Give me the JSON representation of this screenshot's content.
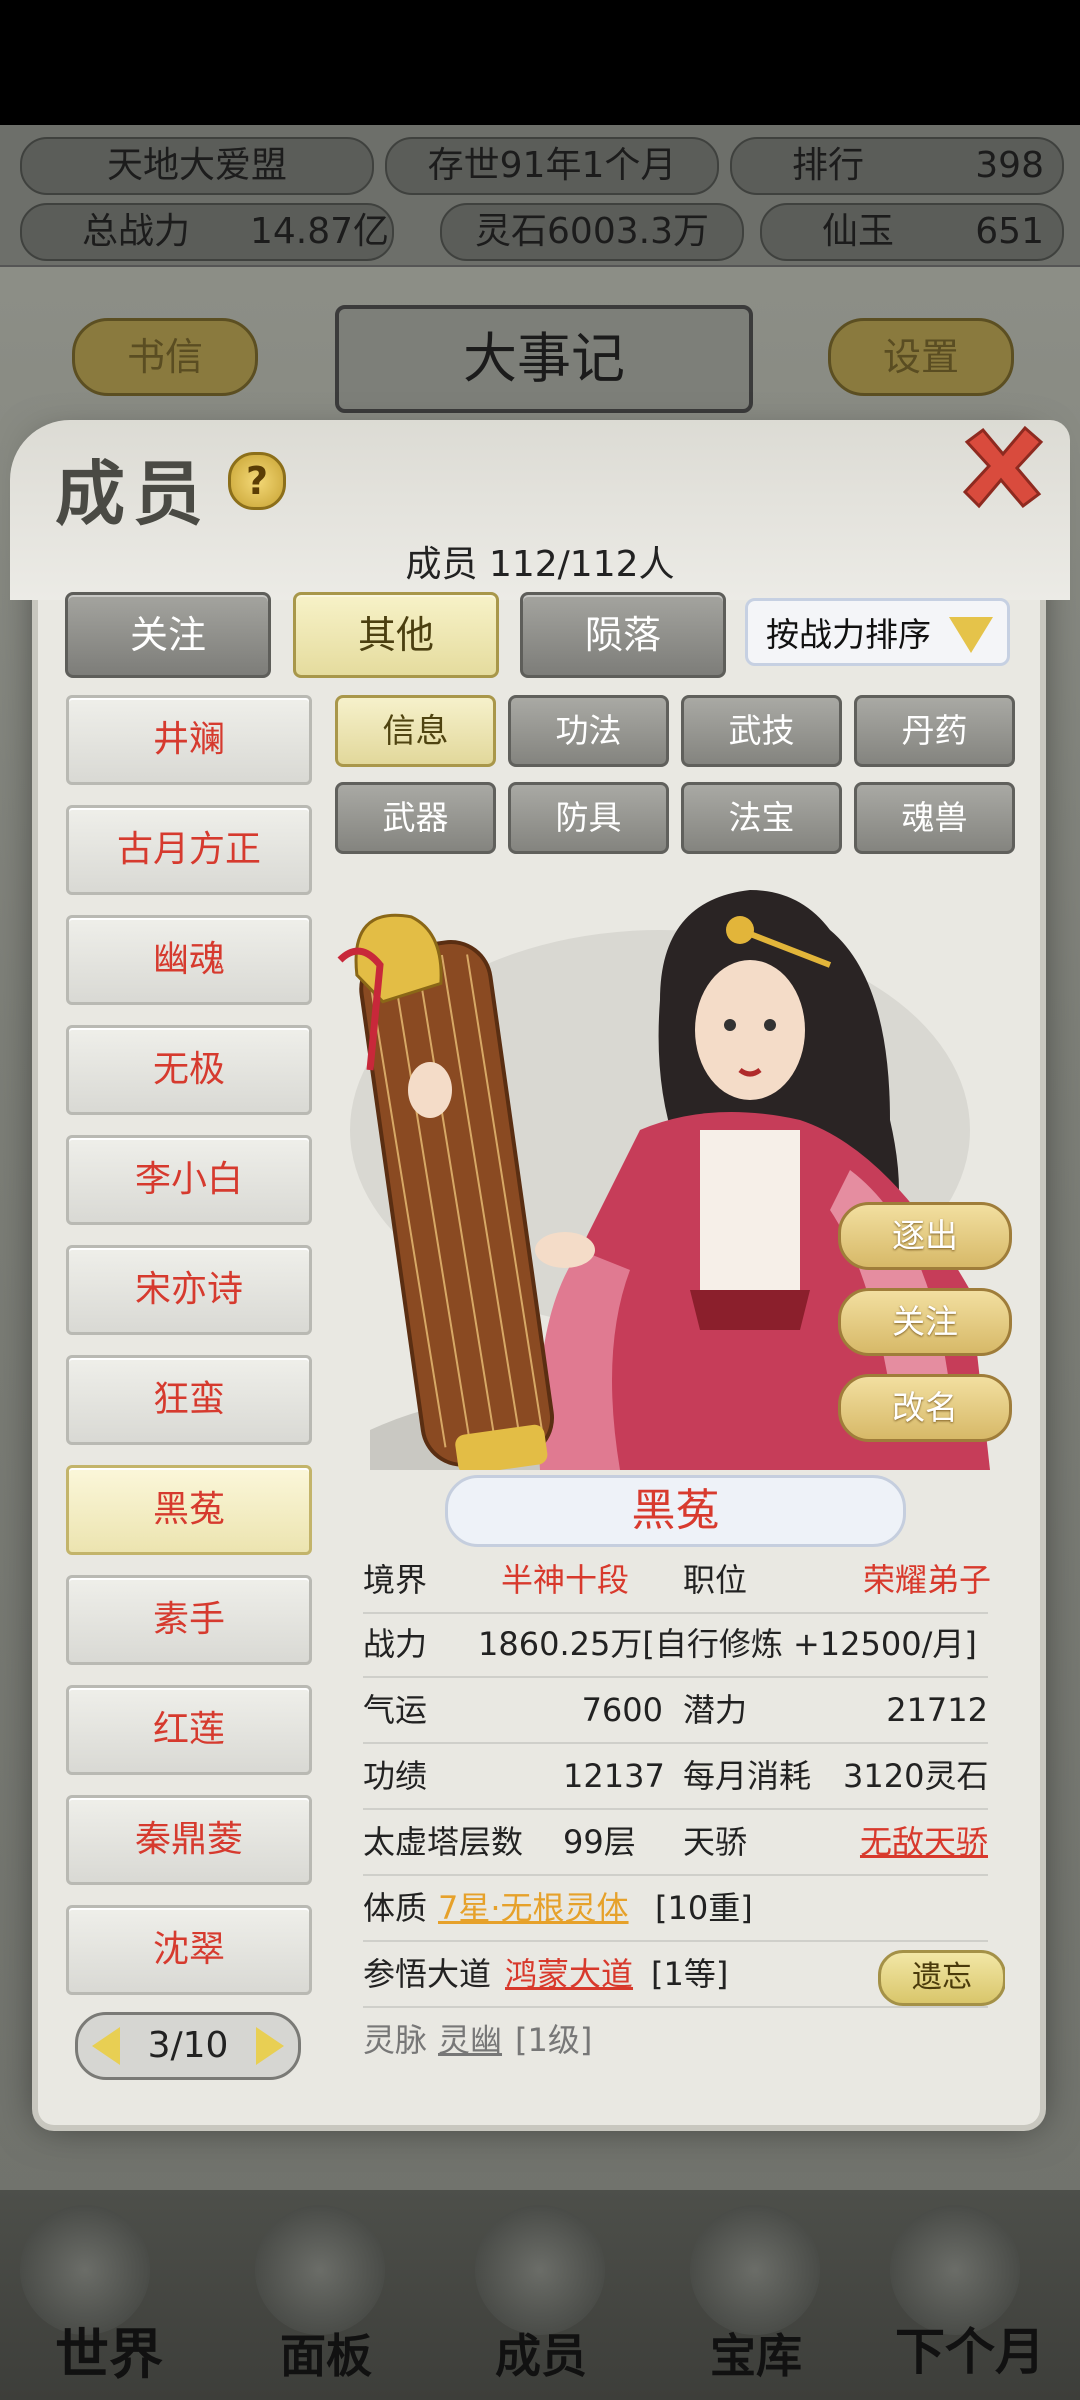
{
  "top": {
    "alliance": "天地大爱盟",
    "era": "存世91年1个月",
    "rank_label": "排行",
    "rank_value": "398",
    "power_label": "总战力",
    "power_value": "14.87亿",
    "spirit_stone": "灵石6003.3万",
    "jade_label": "仙玉",
    "jade_value": "651"
  },
  "header": {
    "mail_label": "书信",
    "title": "大事记",
    "settings_label": "设置"
  },
  "modal": {
    "title": "成员",
    "help": "?",
    "member_count": "成员  112/112人",
    "tabs": [
      "关注",
      "其他",
      "陨落"
    ],
    "active_tab": "其他",
    "sort": "按战力排序",
    "categories": [
      "信息",
      "功法",
      "武技",
      "丹药",
      "武器",
      "防具",
      "法宝",
      "魂兽"
    ],
    "active_category": "信息",
    "members": [
      "井斓",
      "古月方正",
      "幽魂",
      "无极",
      "李小白",
      "宋亦诗",
      "狂蛮",
      "黑菟",
      "素手",
      "红莲",
      "秦鼎菱",
      "沈翠"
    ],
    "selected_member": "黑菟",
    "pager": "3/10",
    "actions": [
      "逐出",
      "关注",
      "改名"
    ],
    "name": "黑菟",
    "stats": {
      "realm_label": "境界",
      "realm_value": "半神十段",
      "position_label": "职位",
      "position_value": "荣耀弟子",
      "power_label": "战力",
      "power_value": "1860.25万[自行修炼 +12500/月]",
      "luck_label": "气运",
      "luck_value": "7600",
      "potential_label": "潜力",
      "potential_value": "21712",
      "merit_label": "功绩",
      "merit_value": "12137",
      "cost_label": "每月消耗",
      "cost_value": "3120灵石",
      "tower_label": "太虚塔层数",
      "tower_value": "99层",
      "genius_label": "天骄",
      "genius_value": "无敌天骄",
      "physique_label": "体质",
      "physique_value": "7星·无根灵体",
      "physique_level": "[10重]",
      "dao_label": "参悟大道",
      "dao_value": "鸿蒙大道",
      "dao_level": "[1等]",
      "forget_label": "遗忘",
      "vein_label": "灵脉",
      "vein_value": "灵幽",
      "vein_level": "[1级]"
    }
  },
  "nav": [
    "世界",
    "面板",
    "成员",
    "宝库",
    "下个月"
  ]
}
